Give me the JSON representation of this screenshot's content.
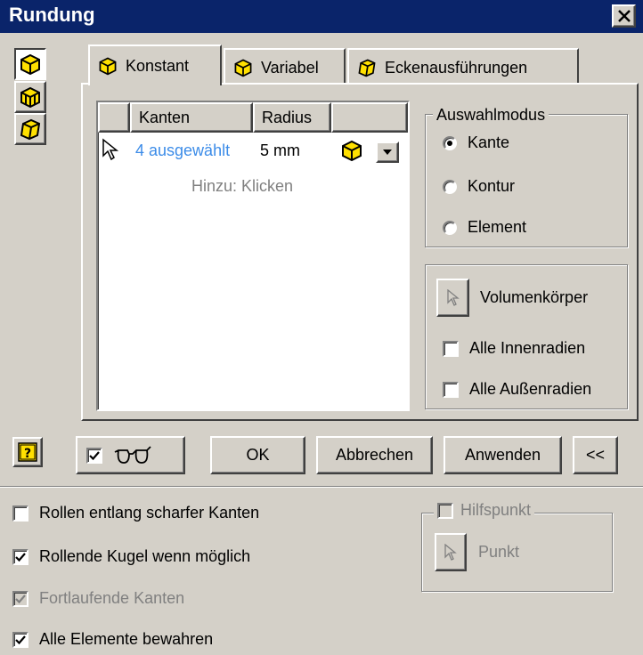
{
  "window": {
    "title": "Rundung"
  },
  "tabs": [
    {
      "label": "Konstant",
      "active": true
    },
    {
      "label": "Variabel",
      "active": false
    },
    {
      "label": "Eckenausführungen",
      "active": false
    }
  ],
  "table": {
    "headers": [
      "Kanten",
      "Radius"
    ],
    "rows": [
      {
        "edges": "4 ausgewählt",
        "radius": "5 mm"
      }
    ],
    "add_hint": "Hinzu: Klicken"
  },
  "selection_mode": {
    "label": "Auswahlmodus",
    "options": [
      {
        "label": "Kante",
        "selected": true
      },
      {
        "label": "Kontur",
        "selected": false
      },
      {
        "label": "Element",
        "selected": false
      }
    ]
  },
  "solid": {
    "label": "Volumenkörper"
  },
  "radii": {
    "inner": {
      "label": "Alle Innenradien",
      "checked": false
    },
    "outer": {
      "label": "Alle Außenradien",
      "checked": false
    }
  },
  "buttons": {
    "ok": "OK",
    "cancel": "Abbrechen",
    "apply": "Anwenden",
    "more": "<<"
  },
  "options": [
    {
      "label": "Rollen entlang scharfer Kanten",
      "checked": false,
      "enabled": true
    },
    {
      "label": "Rollende Kugel wenn möglich",
      "checked": true,
      "enabled": true
    },
    {
      "label": "Fortlaufende Kanten",
      "checked": true,
      "enabled": false
    },
    {
      "label": "Alle Elemente bewahren",
      "checked": true,
      "enabled": true
    }
  ],
  "helper_point": {
    "label": "Hilfspunkt",
    "button": "Punkt"
  },
  "colors": {
    "titlebar": "#0a246a",
    "link_blue": "#3c8ce8",
    "face": "#d4d0c8",
    "icon_yellow": "#ffe000"
  },
  "icons": [
    "cube-face-icon",
    "cube-edge-icon",
    "cube-solid-icon",
    "help-icon",
    "glasses-icon",
    "cursor-arrow-icon",
    "chevron-down-icon",
    "close-icon"
  ]
}
